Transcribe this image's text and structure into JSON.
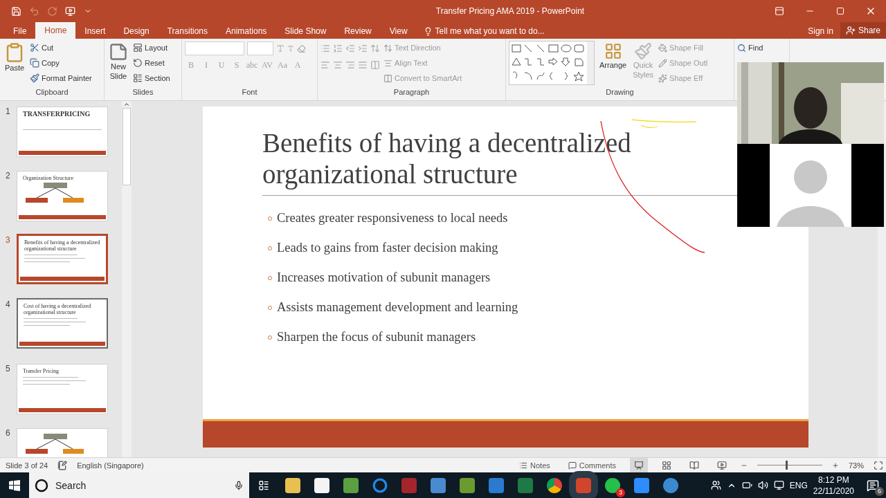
{
  "title_bar": {
    "title": "Transfer Pricing AMA 2019 - PowerPoint"
  },
  "tabs": [
    {
      "label": "File",
      "selected": false
    },
    {
      "label": "Home",
      "selected": true
    },
    {
      "label": "Insert",
      "selected": false
    },
    {
      "label": "Design",
      "selected": false
    },
    {
      "label": "Transitions",
      "selected": false
    },
    {
      "label": "Animations",
      "selected": false
    },
    {
      "label": "Slide Show",
      "selected": false
    },
    {
      "label": "Review",
      "selected": false
    },
    {
      "label": "View",
      "selected": false
    }
  ],
  "tell_me": {
    "placeholder": "Tell me what you want to do..."
  },
  "sign_in": "Sign in",
  "share": "Share",
  "ribbon": {
    "clipboard": {
      "label": "Clipboard",
      "paste": "Paste",
      "items": [
        "Cut",
        "Copy",
        "Format Painter"
      ]
    },
    "slides": {
      "label": "Slides",
      "new_slide": [
        "New",
        "Slide"
      ],
      "items": [
        "Layout",
        "Reset",
        "Section"
      ]
    },
    "font": {
      "label": "Font",
      "buttons": [
        "B",
        "I",
        "U",
        "S",
        "abc",
        "AV",
        "Aa",
        "A"
      ]
    },
    "paragraph": {
      "label": "Paragraph",
      "items": [
        "Text Direction",
        "Align Text",
        "Convert to SmartArt"
      ]
    },
    "drawing": {
      "label": "Drawing",
      "arrange": "Arrange",
      "quick_styles": [
        "Quick",
        "Styles"
      ],
      "items": [
        "Shape Fill",
        "Shape Outl",
        "Shape Eff"
      ]
    },
    "editing": {
      "find": "Find"
    }
  },
  "thumbnails": [
    {
      "number": "1",
      "title": "TRANSFERPRICING",
      "kind": "title",
      "selected": false,
      "hovered": false
    },
    {
      "number": "2",
      "title": "Organization Structure",
      "kind": "chart",
      "selected": false,
      "hovered": false
    },
    {
      "number": "3",
      "title": "Benefits of having a decentralized organizational structure",
      "kind": "bullets",
      "selected": true,
      "hovered": false
    },
    {
      "number": "4",
      "title": "Cost of having a decentralized organizational structure",
      "kind": "bullets",
      "selected": false,
      "hovered": true
    },
    {
      "number": "5",
      "title": "Transfer Pricing",
      "kind": "bullets",
      "selected": false,
      "hovered": false
    },
    {
      "number": "6",
      "kind": "chart",
      "selected": false,
      "hovered": false
    }
  ],
  "slide": {
    "title": "Benefits of having a decentralized organizational structure",
    "bullets": [
      "Creates greater responsiveness to local needs",
      "Leads to gains from faster decision making",
      "Increases motivation of subunit managers",
      "Assists management development and learning",
      "Sharpen the focus of subunit managers"
    ]
  },
  "status_bar": {
    "slide_count": "Slide 3 of 24",
    "language": "English (Singapore)",
    "notes": "Notes",
    "comments": "Comments",
    "zoom": {
      "level": 0.44,
      "reading": "73%"
    }
  },
  "taskbar": {
    "search": {
      "placeholder": "Search"
    },
    "whatsapp_badge": "3",
    "language": "ENG",
    "time": "8:12 PM",
    "date": "22/11/2020",
    "notification_count": "6"
  }
}
